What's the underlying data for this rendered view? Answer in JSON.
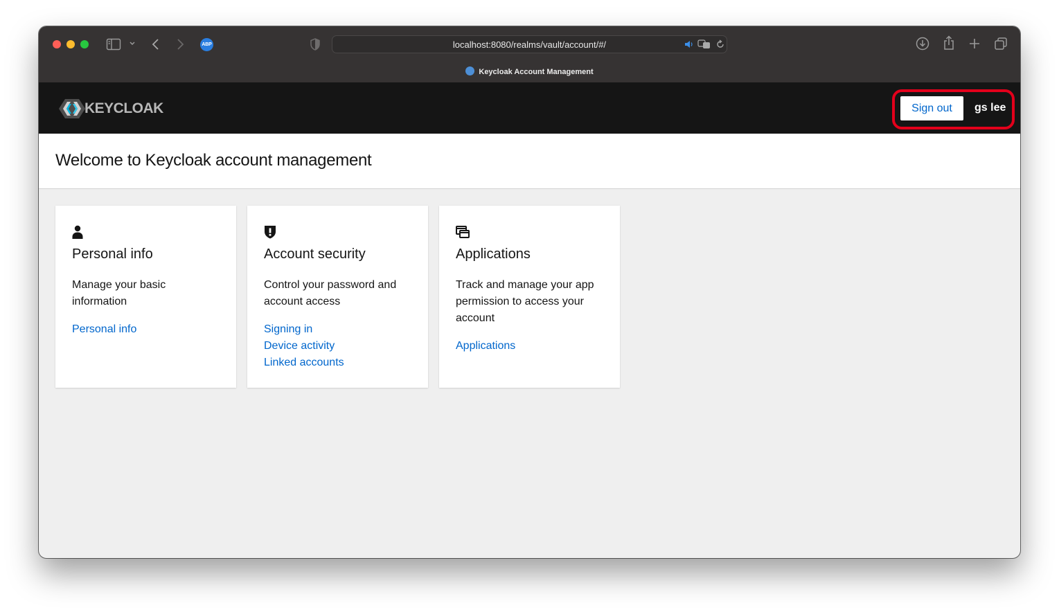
{
  "browser": {
    "url": "localhost:8080/realms/vault/account/#/",
    "tab_title": "Keycloak Account Management",
    "extension_label": "ABP"
  },
  "header": {
    "logo_text": "KEYCLOAK",
    "sign_out_label": "Sign out",
    "username": "gs lee",
    "highlight_color": "#e3001b"
  },
  "page": {
    "welcome_title": "Welcome to Keycloak account management"
  },
  "cards": [
    {
      "icon": "user-icon",
      "title": "Personal info",
      "description": "Manage your basic information",
      "links": [
        "Personal info"
      ]
    },
    {
      "icon": "shield-icon",
      "title": "Account security",
      "description": "Control your password and account access",
      "links": [
        "Signing in",
        "Device activity",
        "Linked accounts"
      ]
    },
    {
      "icon": "applications-icon",
      "title": "Applications",
      "description": "Track and manage your app permission to access your account",
      "links": [
        "Applications"
      ]
    }
  ],
  "colors": {
    "link": "#0066cc",
    "header_bg": "#151515",
    "page_bg": "#efefef"
  }
}
